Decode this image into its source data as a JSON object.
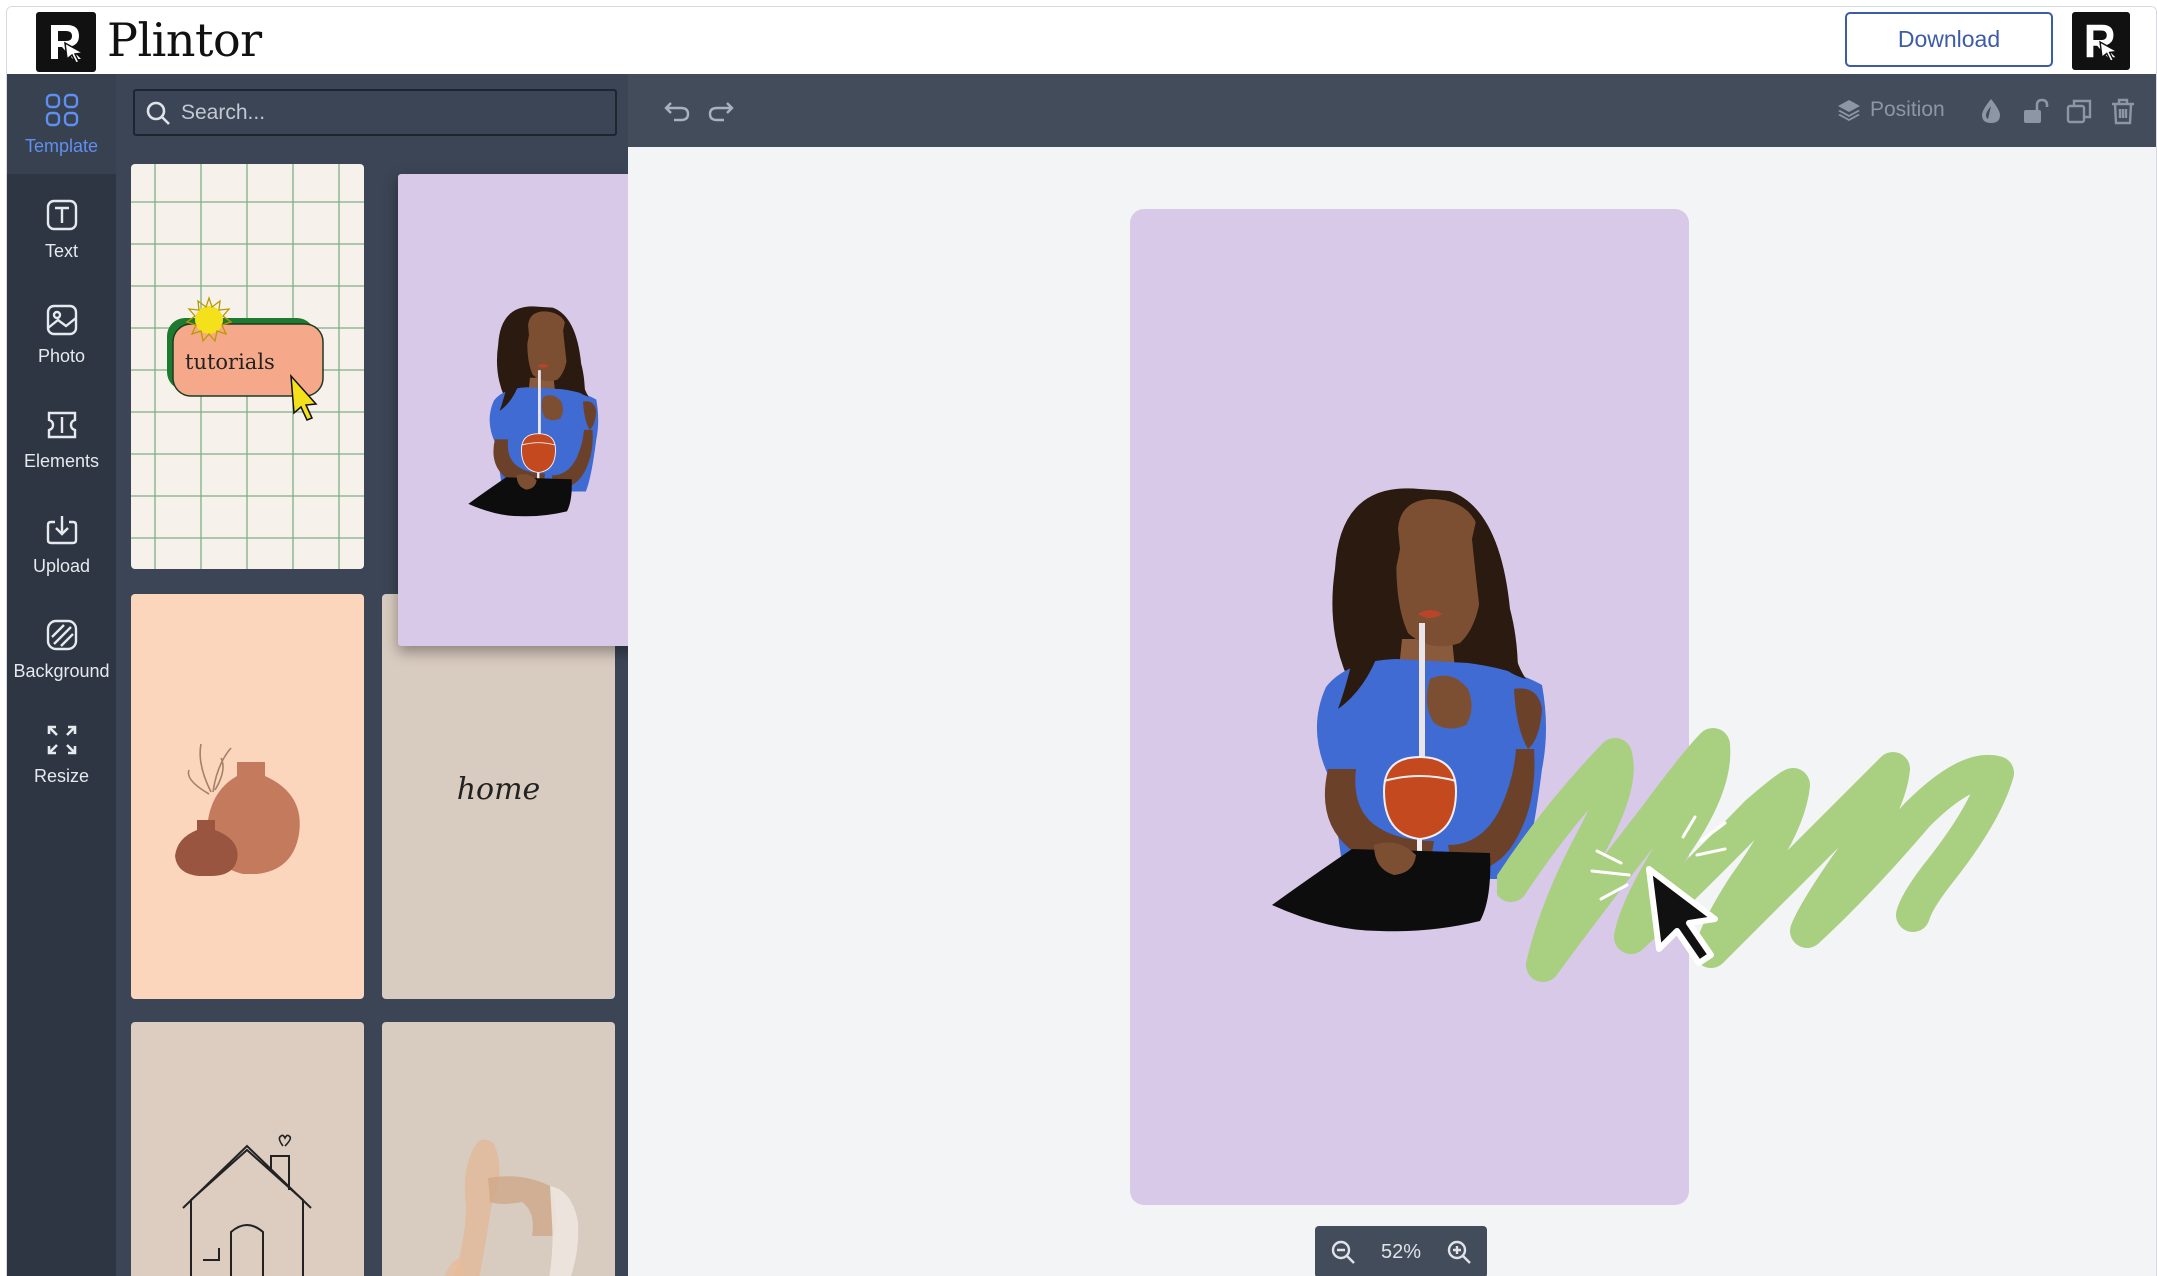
{
  "app": {
    "brand_name": "Plintor",
    "download_label": "Download"
  },
  "nav": {
    "items": [
      {
        "id": "template",
        "label": "Template",
        "icon": "grid-icon",
        "active": true
      },
      {
        "id": "text",
        "label": "Text",
        "icon": "text-icon",
        "active": false
      },
      {
        "id": "photo",
        "label": "Photo",
        "icon": "photo-icon",
        "active": false
      },
      {
        "id": "elements",
        "label": "Elements",
        "icon": "elements-icon",
        "active": false
      },
      {
        "id": "upload",
        "label": "Upload",
        "icon": "upload-icon",
        "active": false
      },
      {
        "id": "background",
        "label": "Background",
        "icon": "background-icon",
        "active": false
      },
      {
        "id": "resize",
        "label": "Resize",
        "icon": "resize-icon",
        "active": false
      }
    ]
  },
  "panel": {
    "search_placeholder": "Search...",
    "templates": [
      {
        "id": "tutorials",
        "text": "tutorials"
      },
      {
        "id": "woman-drink"
      },
      {
        "id": "vases"
      },
      {
        "id": "home",
        "text": "home"
      },
      {
        "id": "house"
      },
      {
        "id": "yoga"
      }
    ]
  },
  "toolbar": {
    "position_label": "Position"
  },
  "zoom": {
    "level": "52%"
  },
  "colors": {
    "accent": "#5f8ff0",
    "rail_bg": "#2d3642",
    "panel_bg": "#3b4555",
    "toolbar_bg": "#434c5b",
    "design_bg": "#d9c9e8",
    "scribble": "#a9cf80"
  }
}
